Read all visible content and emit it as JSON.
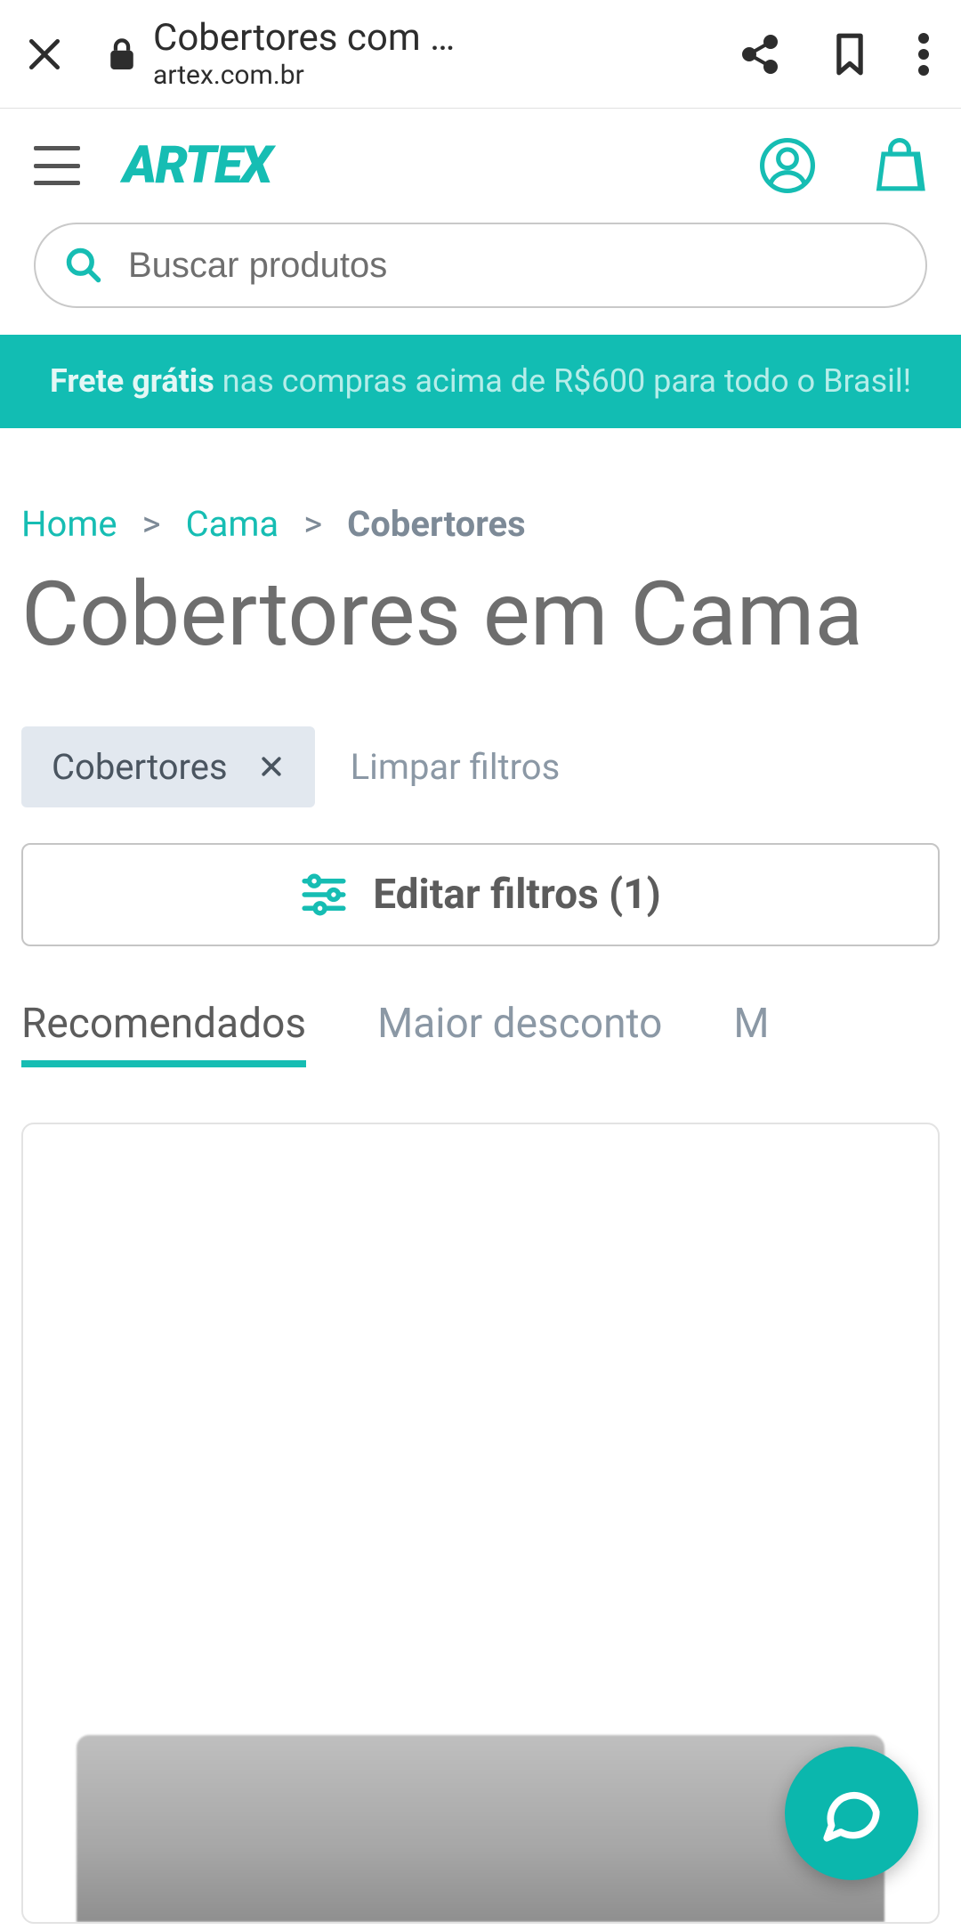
{
  "browser": {
    "title": "Cobertores com …",
    "url": "artex.com.br"
  },
  "header": {
    "logo": "ARTEX"
  },
  "search": {
    "placeholder": "Buscar produtos"
  },
  "promo": {
    "bold": "Frete grátis",
    "rest": " nas compras acima de R$600 para todo o Brasil!"
  },
  "breadcrumb": {
    "items": [
      {
        "label": "Home",
        "type": "link"
      },
      {
        "label": "Cama",
        "type": "link"
      },
      {
        "label": "Cobertores",
        "type": "current"
      }
    ],
    "separator": ">"
  },
  "page_title": "Cobertores em Cama",
  "filters": {
    "chips": [
      {
        "label": "Cobertores"
      }
    ],
    "clear_label": "Limpar filtros",
    "edit_label": "Editar filtros (1)"
  },
  "sort": {
    "tabs": [
      {
        "label": "Recomendados",
        "active": true
      },
      {
        "label": "Maior desconto",
        "active": false
      },
      {
        "label": "M",
        "active": false
      }
    ]
  },
  "colors": {
    "brand": "#16bdb3"
  }
}
